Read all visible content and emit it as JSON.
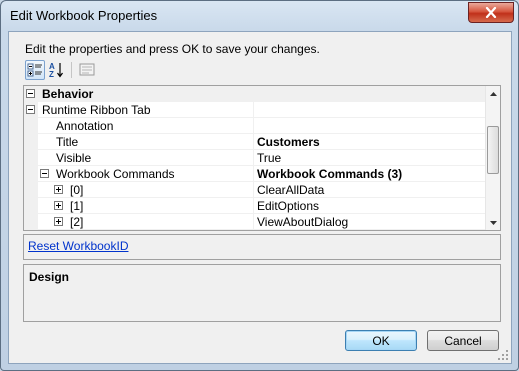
{
  "window": {
    "title": "Edit Workbook Properties"
  },
  "instruction": "Edit the properties and press OK to save your changes.",
  "toolbar": {
    "categorized_icon": "categorized-icon",
    "alphabetical_icon": "alphabetical-icon",
    "property_pages_icon": "property-pages-icon",
    "alpha_label": "A↓Z"
  },
  "grid": {
    "rows": [
      {
        "name": "Behavior",
        "value": "",
        "level": 0,
        "expander": "minus",
        "category": true
      },
      {
        "name": "Runtime Ribbon Tab",
        "value": "",
        "level": 0,
        "expander": "minus",
        "category": false
      },
      {
        "name": "Annotation",
        "value": "",
        "level": 1,
        "expander": "",
        "category": false
      },
      {
        "name": "Title",
        "value": "Customers",
        "level": 1,
        "expander": "",
        "value_bold": true
      },
      {
        "name": "Visible",
        "value": "True",
        "level": 1,
        "expander": ""
      },
      {
        "name": "Workbook Commands",
        "value": "Workbook Commands (3)",
        "level": 1,
        "expander": "minus",
        "value_bold": true
      },
      {
        "name": "[0]",
        "value": "ClearAllData",
        "level": 2,
        "expander": "plus"
      },
      {
        "name": "[1]",
        "value": "EditOptions",
        "level": 2,
        "expander": "plus"
      },
      {
        "name": "[2]",
        "value": "ViewAboutDialog",
        "level": 2,
        "expander": "plus"
      }
    ]
  },
  "command_link": "Reset WorkbookID",
  "description": {
    "title": "Design"
  },
  "buttons": {
    "ok": "OK",
    "cancel": "Cancel"
  },
  "colors": {
    "link": "#0033cc",
    "close_button": "#c0301a"
  }
}
